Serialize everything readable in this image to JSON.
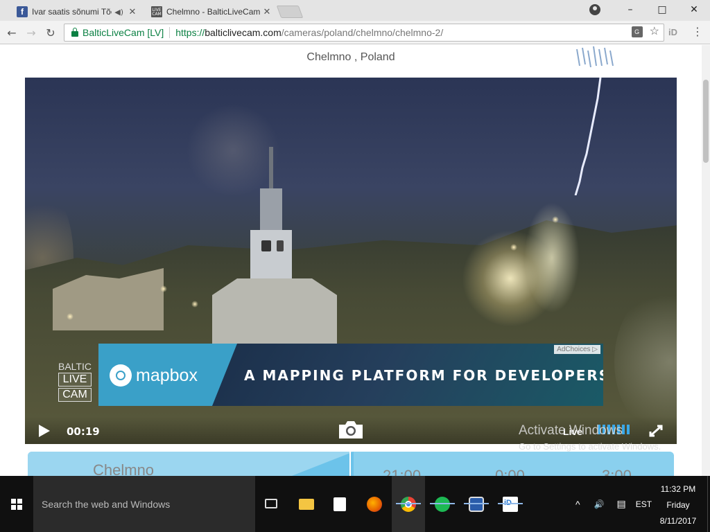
{
  "browser": {
    "tabs": [
      {
        "title": "Ivar saatis sõnumi Tõe",
        "favicon": "facebook-icon",
        "favicon_text": "f",
        "has_audio": true
      },
      {
        "title": "Chelmno - BalticLiveCam",
        "favicon": "balticlivecam-icon",
        "favicon_text": "LIVE CAM",
        "active": true
      }
    ],
    "window_controls": {
      "minimize": "–",
      "maximize": "□",
      "close": "✕"
    },
    "nav": {
      "back": "←",
      "forward": "→",
      "reload": "↻"
    },
    "address": {
      "secure_label": "BalticLiveCam [LV]",
      "scheme": "https://",
      "host": "balticlivecam.com",
      "path": "/cameras/poland/chelmno/chelmno-2/"
    },
    "star": "☆",
    "translate": "G",
    "extension": "iD",
    "menu": "⋮"
  },
  "page": {
    "title": "Chelmno , Poland",
    "ad": {
      "brand": "mapbox",
      "headline": "A MAPPING PLATFORM FOR DEVELOPERS",
      "adchoices": "AdChoices ▷"
    },
    "watermark": [
      "BALTIC",
      "LIVE",
      "CAM"
    ],
    "player": {
      "time": "00:19",
      "live_label": "Live",
      "signal_level": 1.0
    },
    "activation": {
      "title": "Activate Windows",
      "subtitle": "Go to Settings to activate Windows."
    },
    "forecast": {
      "city": "Chelmno",
      "times": [
        "21:00",
        "0:00",
        "3:00"
      ]
    }
  },
  "taskbar": {
    "search_placeholder": "Search the web and Windows",
    "apps": [
      {
        "name": "file-explorer-icon",
        "color": "#f4c542"
      },
      {
        "name": "store-icon",
        "color": "#ffffff"
      },
      {
        "name": "firefox-icon",
        "color": "#e66000"
      },
      {
        "name": "chrome-icon",
        "color": "#4285f4",
        "active": true
      },
      {
        "name": "spotify-icon",
        "color": "#1db954"
      },
      {
        "name": "elisa-icon",
        "color": "#2a5caa"
      },
      {
        "name": "id-updater-icon",
        "color": "#2a7bd4"
      }
    ],
    "tray": {
      "chevron": "^",
      "volume": "🔊",
      "notifications": "▤",
      "language": "EST"
    },
    "clock": {
      "time": "11:32 PM",
      "day": "Friday",
      "date": "8/11/2017"
    }
  }
}
